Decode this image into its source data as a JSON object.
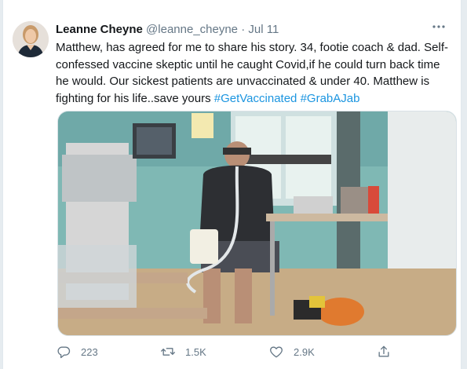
{
  "tweet": {
    "author_name": "Leanne Cheyne",
    "handle": "@leanne_cheyne",
    "separator": "·",
    "date": "Jul 11",
    "more_icon": "more-icon",
    "text_main": "Matthew, has agreed for me to share his story. 34, footie coach & dad. Self-confessed vaccine skeptic until he caught Covid,if he could turn back time he would. Our sickest patients are unvaccinated & under 40. Matthew is fighting for his life..save yours",
    "hashtags": [
      "#GetVaccinated",
      "#GrabAJab"
    ]
  },
  "media": {
    "description_icon": "hospital-room-photo"
  },
  "actions": {
    "replies": "223",
    "retweets": "1.5K",
    "likes": "2.9K",
    "icons": [
      "reply-icon",
      "retweet-icon",
      "like-icon",
      "share-icon"
    ]
  },
  "colors": {
    "accent": "#1b95e0",
    "text": "#14171a",
    "muted": "#657786",
    "background": "#e6ecf0"
  }
}
